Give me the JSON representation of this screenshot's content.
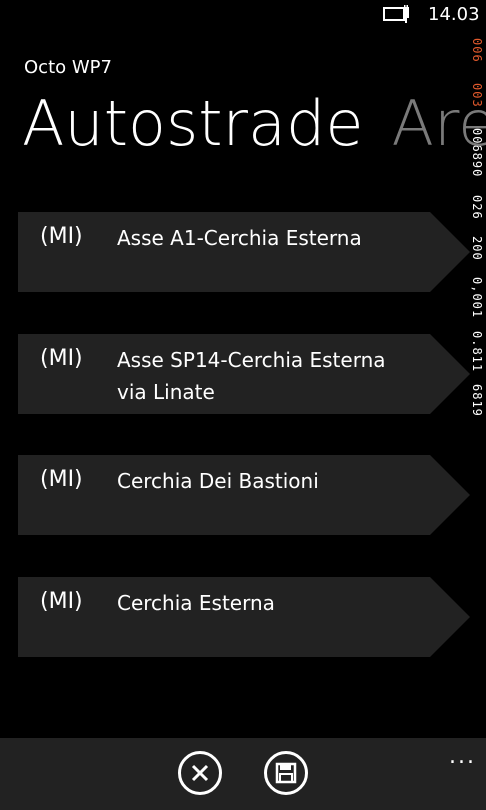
{
  "status": {
    "time": "14.03"
  },
  "perf": {
    "counter1": "006",
    "counter2": "003",
    "counter3": "006890",
    "counter4": "026",
    "counter5": "200",
    "counter6": "0,001",
    "counter7": "0.811",
    "counter8": "6819"
  },
  "app": {
    "title": "Octo WP7"
  },
  "pivot": {
    "active": "Autostrade",
    "next": "Are"
  },
  "routes": [
    {
      "code": "(MI)",
      "name": "Asse A1-Cerchia Esterna"
    },
    {
      "code": "(MI)",
      "name": "Asse SP14-Cerchia Esterna via Linate"
    },
    {
      "code": "(MI)",
      "name": "Cerchia Dei Bastioni"
    },
    {
      "code": "(MI)",
      "name": "Cerchia Esterna"
    }
  ],
  "appbar": {
    "more": "..."
  }
}
